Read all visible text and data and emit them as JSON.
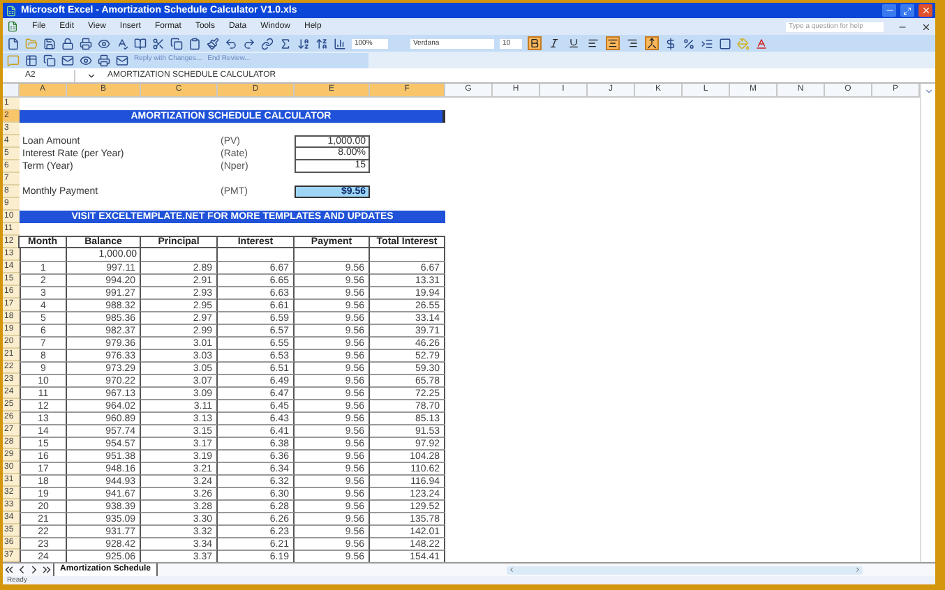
{
  "window": {
    "title": "Microsoft Excel - Amortization Schedule Calculator V1.0.xls"
  },
  "menu": [
    "File",
    "Edit",
    "View",
    "Insert",
    "Format",
    "Tools",
    "Data",
    "Window",
    "Help"
  ],
  "help": {
    "placeholder": "Type a question for help"
  },
  "standard_toolbar": {
    "zoom": "100%"
  },
  "formatting_toolbar": {
    "font": "Verdana",
    "size": "10",
    "styles": [
      {
        "kind": "bold",
        "selected": true
      },
      {
        "kind": "italic",
        "selected": false
      },
      {
        "kind": "underline",
        "selected": false
      }
    ],
    "alignments": [
      {
        "kind": "left",
        "selected": false
      },
      {
        "kind": "center",
        "selected": true
      },
      {
        "kind": "right",
        "selected": false
      },
      {
        "kind": "merge",
        "selected": true
      }
    ]
  },
  "review_toolbar": [
    "Reply with Changes...",
    "End Review..."
  ],
  "formula_bar": {
    "cell": "A2",
    "content": "AMORTIZATION SCHEDULE CALCULATOR"
  },
  "columns": [
    {
      "label": "A",
      "selected": true
    },
    {
      "label": "B",
      "selected": true
    },
    {
      "label": "C",
      "selected": true
    },
    {
      "label": "D",
      "selected": true
    },
    {
      "label": "E",
      "selected": true
    },
    {
      "label": "F",
      "selected": true
    },
    {
      "label": "G",
      "selected": false
    },
    {
      "label": "H",
      "selected": false
    },
    {
      "label": "I",
      "selected": false
    },
    {
      "label": "J",
      "selected": false
    },
    {
      "label": "K",
      "selected": false
    },
    {
      "label": "L",
      "selected": false
    },
    {
      "label": "M",
      "selected": false
    },
    {
      "label": "N",
      "selected": false
    },
    {
      "label": "O",
      "selected": false
    },
    {
      "label": "P",
      "selected": false
    }
  ],
  "row_headers": [
    {
      "label": "1",
      "selected": false
    },
    {
      "label": "2",
      "selected": true
    },
    {
      "label": "3",
      "selected": false
    },
    {
      "label": "4",
      "selected": false
    },
    {
      "label": "5",
      "selected": false
    },
    {
      "label": "6",
      "selected": false
    },
    {
      "label": "7",
      "selected": false
    },
    {
      "label": "8",
      "selected": false
    },
    {
      "label": "9",
      "selected": false
    },
    {
      "label": "10",
      "selected": false
    },
    {
      "label": "11",
      "selected": false
    },
    {
      "label": "12",
      "selected": false
    },
    {
      "label": "13",
      "selected": false
    },
    {
      "label": "14",
      "selected": false
    },
    {
      "label": "15",
      "selected": false
    },
    {
      "label": "16",
      "selected": false
    },
    {
      "label": "17",
      "selected": false
    },
    {
      "label": "18",
      "selected": false
    },
    {
      "label": "19",
      "selected": false
    },
    {
      "label": "20",
      "selected": false
    },
    {
      "label": "21",
      "selected": false
    },
    {
      "label": "22",
      "selected": false
    },
    {
      "label": "23",
      "selected": false
    },
    {
      "label": "24",
      "selected": false
    },
    {
      "label": "25",
      "selected": false
    },
    {
      "label": "26",
      "selected": false
    },
    {
      "label": "27",
      "selected": false
    },
    {
      "label": "28",
      "selected": false
    },
    {
      "label": "29",
      "selected": false
    },
    {
      "label": "30",
      "selected": false
    },
    {
      "label": "31",
      "selected": false
    },
    {
      "label": "32",
      "selected": false
    },
    {
      "label": "33",
      "selected": false
    },
    {
      "label": "34",
      "selected": false
    },
    {
      "label": "35",
      "selected": false
    },
    {
      "label": "36",
      "selected": false
    },
    {
      "label": "37",
      "selected": false
    }
  ],
  "sheet": {
    "title_banner": "AMORTIZATION SCHEDULE CALCULATOR",
    "inputs": [
      {
        "label": "Loan Amount",
        "code": "(PV)",
        "value": "1,000.00"
      },
      {
        "label": "Interest Rate (per Year)",
        "code": "(Rate)",
        "value": "8.00%"
      },
      {
        "label": "Term (Year)",
        "code": "(Nper)",
        "value": "15"
      }
    ],
    "payment": {
      "label": "Monthly Payment",
      "code": "(PMT)",
      "value": "$9.56"
    },
    "link_banner": "VISIT EXCELTEMPLATE.NET FOR MORE TEMPLATES AND UPDATES",
    "table": {
      "columns": [
        "Month",
        "Balance",
        "Principal",
        "Interest",
        "Payment",
        "Total Interest"
      ],
      "opening_balance": "1,000.00",
      "rows": [
        [
          "1",
          "997.11",
          "2.89",
          "6.67",
          "9.56",
          "6.67"
        ],
        [
          "2",
          "994.20",
          "2.91",
          "6.65",
          "9.56",
          "13.31"
        ],
        [
          "3",
          "991.27",
          "2.93",
          "6.63",
          "9.56",
          "19.94"
        ],
        [
          "4",
          "988.32",
          "2.95",
          "6.61",
          "9.56",
          "26.55"
        ],
        [
          "5",
          "985.36",
          "2.97",
          "6.59",
          "9.56",
          "33.14"
        ],
        [
          "6",
          "982.37",
          "2.99",
          "6.57",
          "9.56",
          "39.71"
        ],
        [
          "7",
          "979.36",
          "3.01",
          "6.55",
          "9.56",
          "46.26"
        ],
        [
          "8",
          "976.33",
          "3.03",
          "6.53",
          "9.56",
          "52.79"
        ],
        [
          "9",
          "973.29",
          "3.05",
          "6.51",
          "9.56",
          "59.30"
        ],
        [
          "10",
          "970.22",
          "3.07",
          "6.49",
          "9.56",
          "65.78"
        ],
        [
          "11",
          "967.13",
          "3.09",
          "6.47",
          "9.56",
          "72.25"
        ],
        [
          "12",
          "964.02",
          "3.11",
          "6.45",
          "9.56",
          "78.70"
        ],
        [
          "13",
          "960.89",
          "3.13",
          "6.43",
          "9.56",
          "85.13"
        ],
        [
          "14",
          "957.74",
          "3.15",
          "6.41",
          "9.56",
          "91.53"
        ],
        [
          "15",
          "954.57",
          "3.17",
          "6.38",
          "9.56",
          "97.92"
        ],
        [
          "16",
          "951.38",
          "3.19",
          "6.36",
          "9.56",
          "104.28"
        ],
        [
          "17",
          "948.16",
          "3.21",
          "6.34",
          "9.56",
          "110.62"
        ],
        [
          "18",
          "944.93",
          "3.24",
          "6.32",
          "9.56",
          "116.94"
        ],
        [
          "19",
          "941.67",
          "3.26",
          "6.30",
          "9.56",
          "123.24"
        ],
        [
          "20",
          "938.39",
          "3.28",
          "6.28",
          "9.56",
          "129.52"
        ],
        [
          "21",
          "935.09",
          "3.30",
          "6.26",
          "9.56",
          "135.78"
        ],
        [
          "22",
          "931.77",
          "3.32",
          "6.23",
          "9.56",
          "142.01"
        ],
        [
          "23",
          "928.42",
          "3.34",
          "6.21",
          "9.56",
          "148.22"
        ],
        [
          "24",
          "925.06",
          "3.37",
          "6.19",
          "9.56",
          "154.41"
        ]
      ]
    }
  },
  "sheet_tabs": [
    {
      "label": "Amortization Schedule",
      "selected": true
    }
  ],
  "status_bar": "Ready"
}
